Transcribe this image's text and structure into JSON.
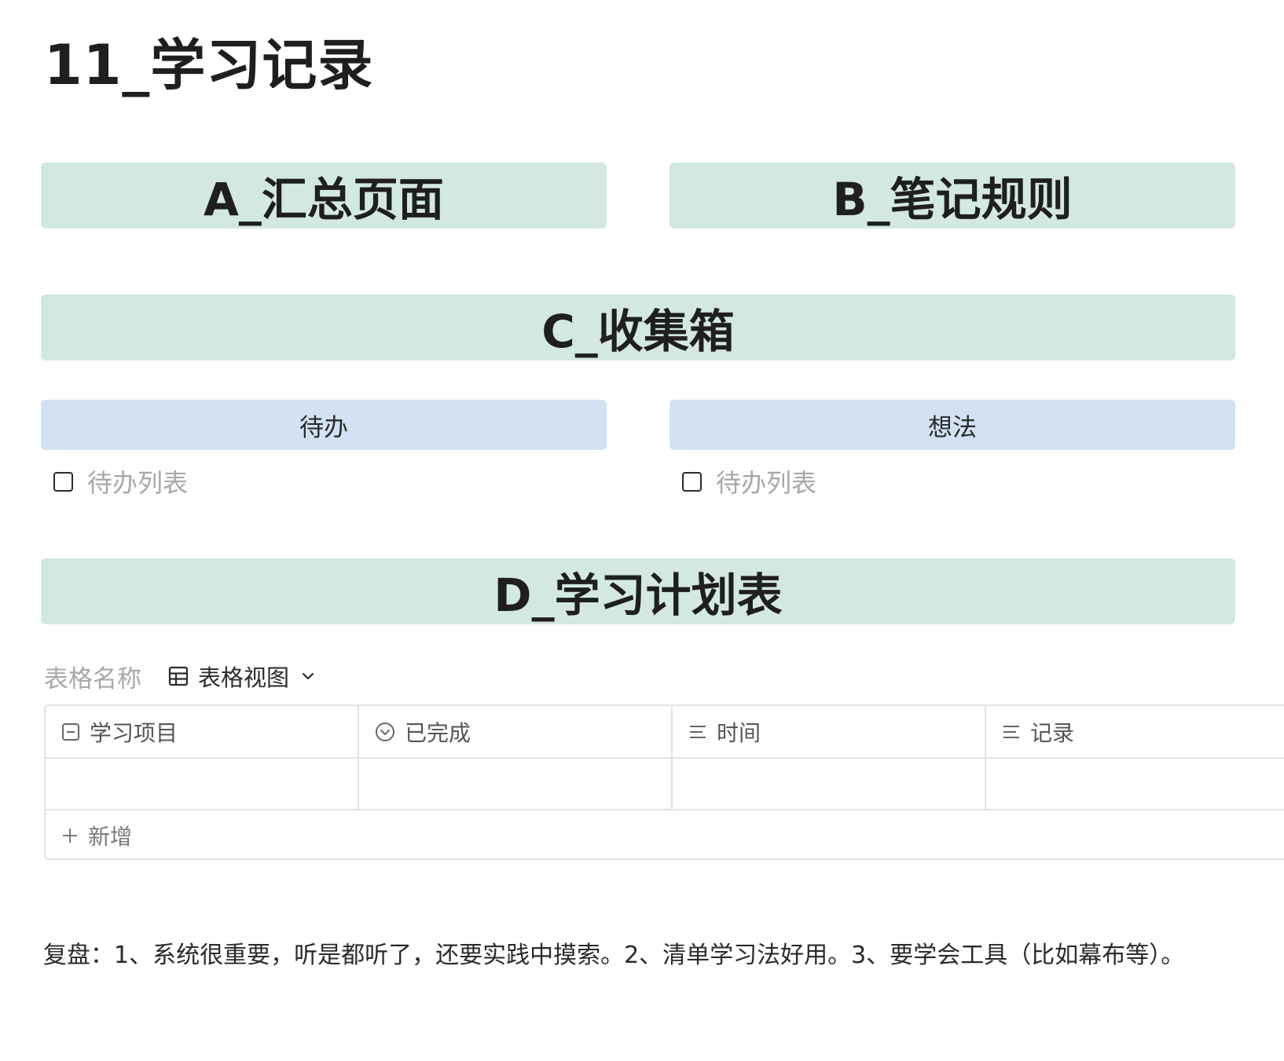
{
  "page": {
    "title": "11_学习记录"
  },
  "banners": {
    "a": "A_汇总页面",
    "b": "B_笔记规则",
    "c": "C_收集箱",
    "d": "D_学习计划表"
  },
  "inbox": {
    "todo_header": "待办",
    "idea_header": "想法",
    "todo_placeholder_left": "待办列表",
    "todo_placeholder_right": "待办列表"
  },
  "table": {
    "name_placeholder": "表格名称",
    "view_label": "表格视图",
    "columns": [
      {
        "label": "学习项目",
        "icon": "title-icon"
      },
      {
        "label": "已完成",
        "icon": "status-icon"
      },
      {
        "label": "时间",
        "icon": "text-lines-icon"
      },
      {
        "label": "记录",
        "icon": "text-lines-icon"
      }
    ],
    "add_label": "新增"
  },
  "review": {
    "text": "复盘：1、系统很重要，听是都听了，还要实践中摸索。2、清单学习法好用。3、要学会工具（比如幕布等）。"
  },
  "colors": {
    "banner_green": "#d3e8e0",
    "header_blue": "#d2e2f2",
    "placeholder_gray": "#a8a8a8",
    "border_gray": "#e3e3e3"
  }
}
